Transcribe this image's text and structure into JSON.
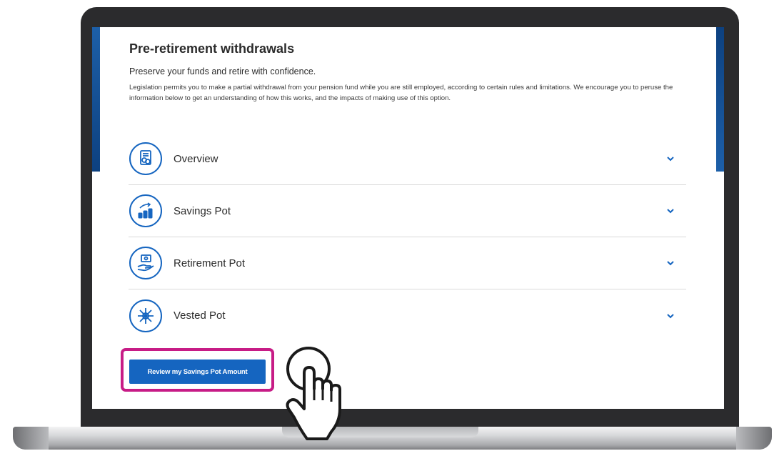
{
  "page": {
    "title": "Pre-retirement withdrawals",
    "subtitle": "Preserve your funds and retire with confidence.",
    "body": "Legislation permits you to make a partial withdrawal from your pension fund while you are still employed, according to certain rules and limitations. We encourage you to peruse the information below to get an understanding of how this works, and the impacts of making use of this option."
  },
  "accordion": {
    "items": [
      {
        "label": "Overview",
        "icon": "document-coins-icon"
      },
      {
        "label": "Savings Pot",
        "icon": "coin-stacks-growth-icon"
      },
      {
        "label": "Retirement Pot",
        "icon": "hand-holding-cash-icon"
      },
      {
        "label": "Vested Pot",
        "icon": "snowflake-icon"
      }
    ]
  },
  "cta": {
    "label": "Review my Savings Pot Amount"
  },
  "colors": {
    "accent": "#1565c0",
    "highlight": "#c71c86",
    "text": "#2b2b2b"
  }
}
